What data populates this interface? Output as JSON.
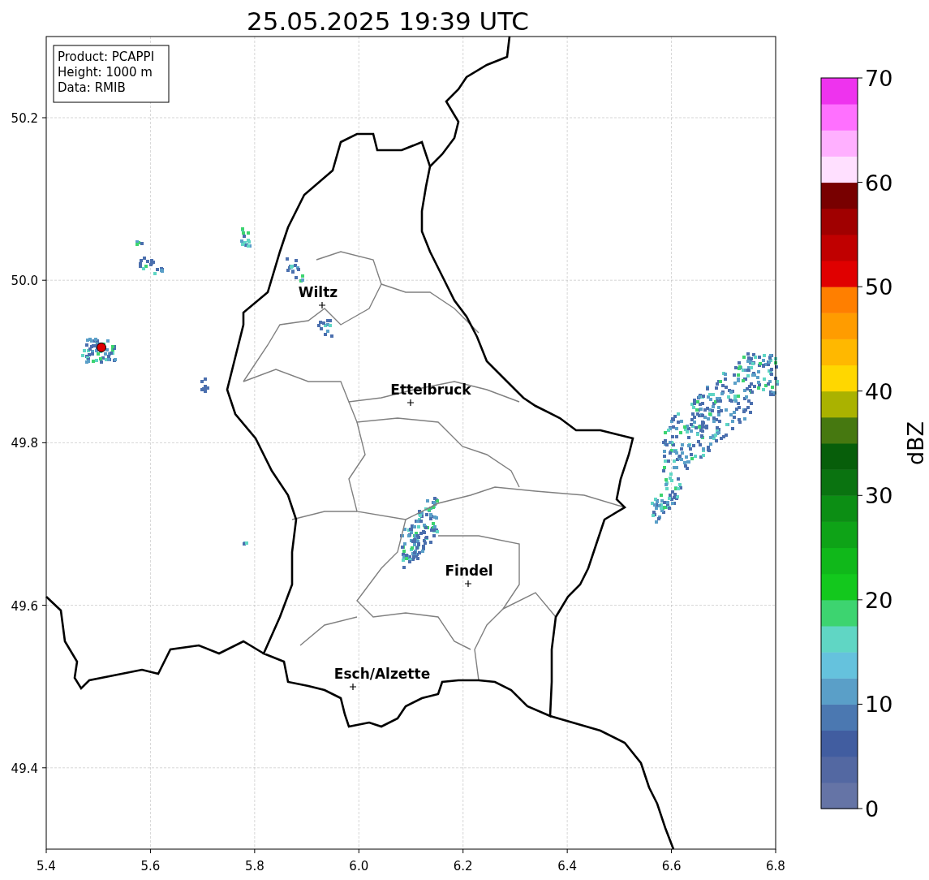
{
  "title": "25.05.2025 19:39 UTC",
  "info_box": [
    "Product: PCAPPI",
    "Height: 1000 m",
    "Data: RMIB"
  ],
  "map": {
    "xticks": [
      "5.4",
      "5.6",
      "5.8",
      "6.0",
      "6.2",
      "6.4",
      "6.6",
      "6.8"
    ],
    "yticks": [
      "50.2",
      "50.0",
      "49.8",
      "49.6",
      "49.4"
    ],
    "cities": [
      {
        "name": "Wiltz"
      },
      {
        "name": "Ettelbruck"
      },
      {
        "name": "Findel"
      },
      {
        "name": "Esch/Alzette"
      }
    ]
  },
  "colorbar": {
    "label": "dBZ",
    "ticks": [
      "70",
      "60",
      "50",
      "40",
      "30",
      "20",
      "10",
      "0"
    ]
  }
}
